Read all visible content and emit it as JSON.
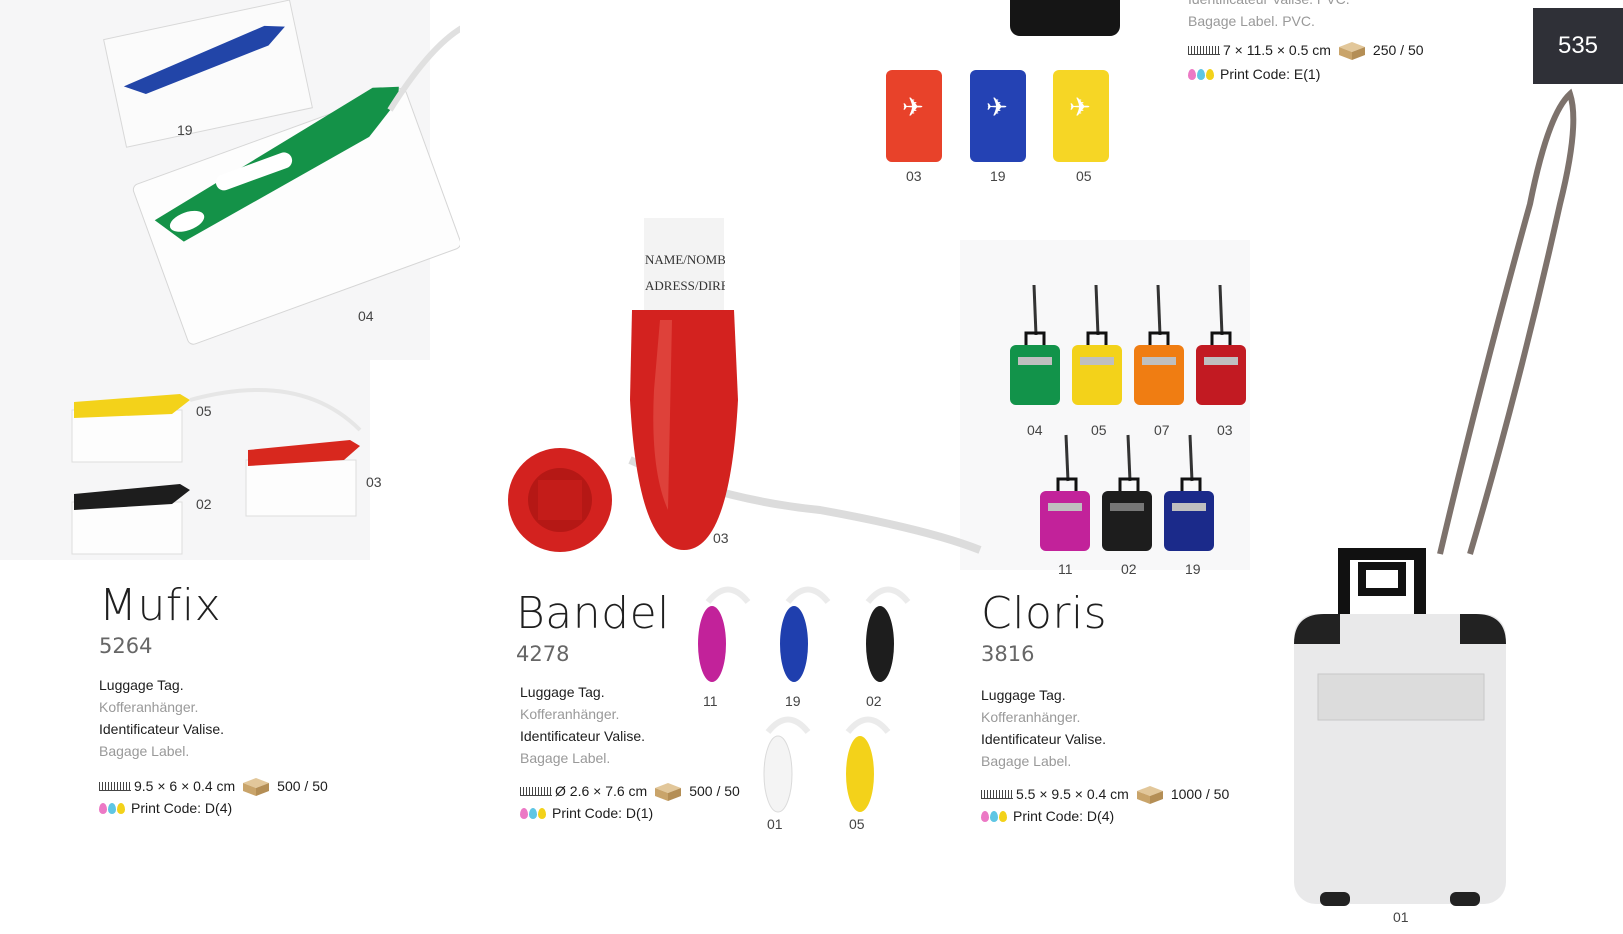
{
  "page": {
    "number": "535"
  },
  "top_product": {
    "desc_partial": "Identificateur Valise. PVC.",
    "desc_en": "Bagage Label. PVC.",
    "dimensions": "7 × 11.5 × 0.5 cm",
    "packing": "250 / 50",
    "print_code": "Print Code: E(1)",
    "variants": [
      "03",
      "19",
      "05"
    ]
  },
  "mufix": {
    "name": "Mufix",
    "code": "5264",
    "desc": [
      "Luggage Tag.",
      "Kofferanhänger.",
      "Identificateur Valise.",
      "Bagage Label."
    ],
    "dimensions": "9.5 × 6 × 0.4 cm",
    "packing": "500 / 50",
    "print_code": "Print Code: D(4)",
    "variants_top": [
      "19",
      "04"
    ],
    "variants_bottom": [
      "05",
      "03",
      "02"
    ]
  },
  "bandel": {
    "name": "Bandel",
    "code": "4278",
    "desc": [
      "Luggage Tag.",
      "Kofferanhänger.",
      "Identificateur Valise.",
      "Bagage Label."
    ],
    "dimensions": "Ø 2.6 × 7.6 cm",
    "packing": "500 / 50",
    "print_code": "Print Code: D(1)",
    "main_variant": "03",
    "label_text": [
      "NAME/NOMBRE",
      "ADRESS/DIRECC"
    ],
    "variants": [
      "11",
      "19",
      "02",
      "01",
      "05"
    ]
  },
  "cloris": {
    "name": "Cloris",
    "code": "3816",
    "desc": [
      "Luggage Tag.",
      "Kofferanhänger.",
      "Identificateur Valise.",
      "Bagage Label."
    ],
    "dimensions": "5.5 × 9.5 × 0.4 cm",
    "packing": "1000 / 50",
    "print_code": "Print Code: D(4)",
    "variants_row1": [
      "04",
      "05",
      "07",
      "03"
    ],
    "variants_row2": [
      "11",
      "02",
      "19"
    ],
    "main_variant": "01"
  },
  "colors": {
    "red": "#d8281e",
    "blue": "#1f3fae",
    "yellow": "#f3d21a",
    "green": "#12934a",
    "orange": "#f07d12",
    "magenta": "#c2229a",
    "black": "#1d1d1d",
    "navy": "#1b2a8a",
    "darkred": "#c21a22",
    "pink": "#ec79c5",
    "cyan": "#5fc6e4",
    "page_tab": "#2f3037"
  }
}
